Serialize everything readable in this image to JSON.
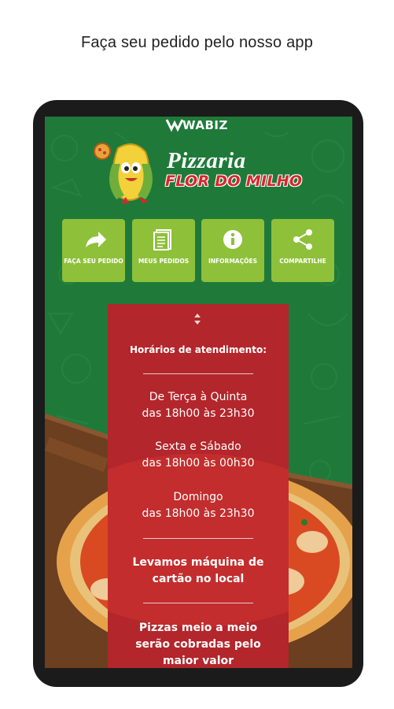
{
  "caption": "Faça seu pedido pelo nosso app",
  "brand": {
    "name": "WABIZ"
  },
  "logo": {
    "line1": "Pizzaria",
    "line2": "FLOR DO MILHO"
  },
  "actions": [
    {
      "label": "FAÇA SEU PEDIDO",
      "icon": "share-forward-icon"
    },
    {
      "label": "MEUS PEDIDOS",
      "icon": "document-list-icon"
    },
    {
      "label": "INFORMAÇÕES",
      "icon": "info-icon"
    },
    {
      "label": "COMPARTILHE",
      "icon": "share-icon"
    }
  ],
  "info": {
    "heading": "Horários de atendimento:",
    "schedules": [
      {
        "days": "De Terça à Quinta",
        "hours": "das 18h00 às 23h30"
      },
      {
        "days": "Sexta e Sábado",
        "hours": "das 18h00 às 00h30"
      },
      {
        "days": "Domingo",
        "hours": "das 18h00 às 23h30"
      }
    ],
    "notes": [
      {
        "line1": "Levamos máquina de",
        "line2": "cartão no local"
      },
      {
        "line1": "Pizzas meio a meio",
        "line2": "serão cobradas pelo",
        "line3": "maior valor"
      }
    ]
  },
  "colors": {
    "background": "#1f7a3a",
    "button": "#8ec03a",
    "panel": "#b3262b",
    "logo_red": "#d9262c"
  }
}
